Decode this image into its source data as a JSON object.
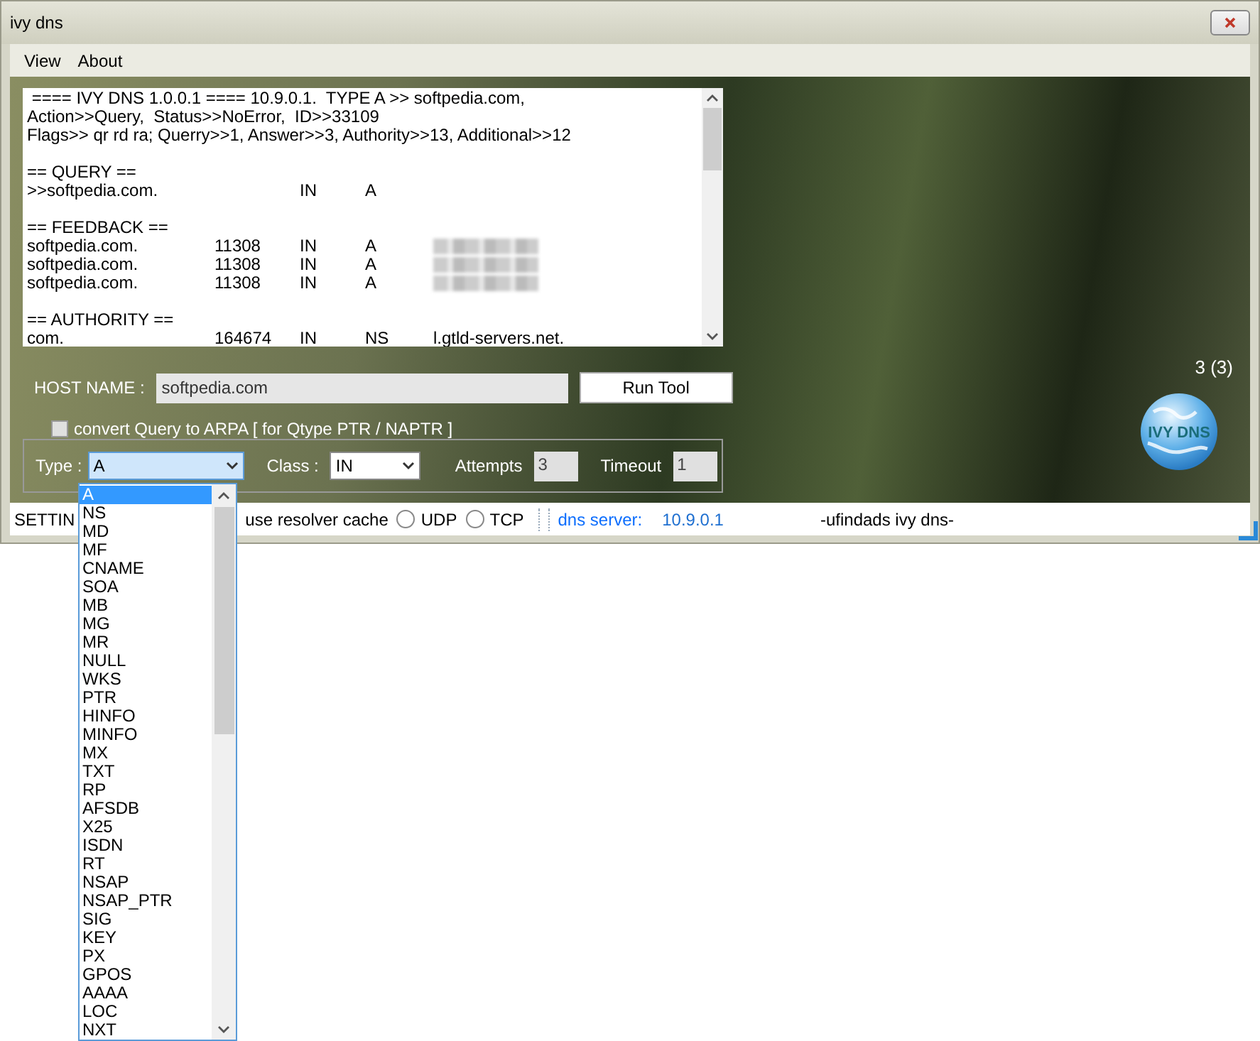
{
  "window": {
    "title": "ivy dns"
  },
  "menu": [
    "View",
    "About"
  ],
  "output_lines": [
    {
      "kind": "text",
      "text": " ==== IVY DNS 1.0.0.1 ==== 10.9.0.1.  TYPE A >> softpedia.com,"
    },
    {
      "kind": "text",
      "text": "Action>>Query,  Status>>NoError,  ID>>33109"
    },
    {
      "kind": "text",
      "text": "Flags>> qr rd ra; Querry>>1, Answer>>3, Authority>>13, Additional>>12"
    },
    {
      "kind": "blank"
    },
    {
      "kind": "text",
      "text": "== QUERY =="
    },
    {
      "kind": "record",
      "name": ">>softpedia.com.",
      "class": "IN",
      "type": "A"
    },
    {
      "kind": "blank"
    },
    {
      "kind": "text",
      "text": "== FEEDBACK =="
    },
    {
      "kind": "record",
      "name": "softpedia.com.",
      "ttl": "11308",
      "class": "IN",
      "type": "A",
      "redacted": true
    },
    {
      "kind": "record",
      "name": "softpedia.com.",
      "ttl": "11308",
      "class": "IN",
      "type": "A",
      "redacted": true
    },
    {
      "kind": "record",
      "name": "softpedia.com.",
      "ttl": "11308",
      "class": "IN",
      "type": "A",
      "redacted": true
    },
    {
      "kind": "blank"
    },
    {
      "kind": "text",
      "text": "== AUTHORITY =="
    },
    {
      "kind": "record",
      "name": "com.",
      "ttl": "164674",
      "class": "IN",
      "type": "NS",
      "data": "l.gtld-servers.net."
    }
  ],
  "result_count": "3 (3)",
  "host": {
    "label": "HOST NAME :",
    "value": "softpedia.com"
  },
  "run_button": "Run Tool",
  "arpa": {
    "label": "convert Query to ARPA [ for Qtype PTR / NAPTR ]",
    "checked": false
  },
  "type": {
    "label": "Type :",
    "value": "A",
    "expanded": true,
    "options": [
      {
        "label": "A",
        "selected": true
      },
      {
        "label": "NS",
        "selected": false
      },
      {
        "label": "MD",
        "selected": false
      },
      {
        "label": "MF",
        "selected": false
      },
      {
        "label": "CNAME",
        "selected": false
      },
      {
        "label": "SOA",
        "selected": false
      },
      {
        "label": "MB",
        "selected": false
      },
      {
        "label": "MG",
        "selected": false
      },
      {
        "label": "MR",
        "selected": false
      },
      {
        "label": "NULL",
        "selected": false
      },
      {
        "label": "WKS",
        "selected": false
      },
      {
        "label": "PTR",
        "selected": false
      },
      {
        "label": "HINFO",
        "selected": false
      },
      {
        "label": "MINFO",
        "selected": false
      },
      {
        "label": "MX",
        "selected": false
      },
      {
        "label": "TXT",
        "selected": false
      },
      {
        "label": "RP",
        "selected": false
      },
      {
        "label": "AFSDB",
        "selected": false
      },
      {
        "label": "X25",
        "selected": false
      },
      {
        "label": "ISDN",
        "selected": false
      },
      {
        "label": "RT",
        "selected": false
      },
      {
        "label": "NSAP",
        "selected": false
      },
      {
        "label": "NSAP_PTR",
        "selected": false
      },
      {
        "label": "SIG",
        "selected": false
      },
      {
        "label": "KEY",
        "selected": false
      },
      {
        "label": "PX",
        "selected": false
      },
      {
        "label": "GPOS",
        "selected": false
      },
      {
        "label": "AAAA",
        "selected": false
      },
      {
        "label": "LOC",
        "selected": false
      },
      {
        "label": "NXT",
        "selected": false
      }
    ]
  },
  "class": {
    "label": "Class :",
    "value": "IN"
  },
  "attempts": {
    "label": "Attempts",
    "value": "3"
  },
  "timeout": {
    "label": "Timeout",
    "value": "1"
  },
  "logo_text": "IVY DNS",
  "status_bar": {
    "settings": "SETTIN",
    "resolver_cache": "use resolver cache",
    "protocols": [
      {
        "label": "UDP",
        "selected": false
      },
      {
        "label": "TCP",
        "selected": false
      }
    ],
    "dns_label": "dns server:",
    "dns_value": "10.9.0.1",
    "footer": "-ufindads ivy dns-"
  }
}
